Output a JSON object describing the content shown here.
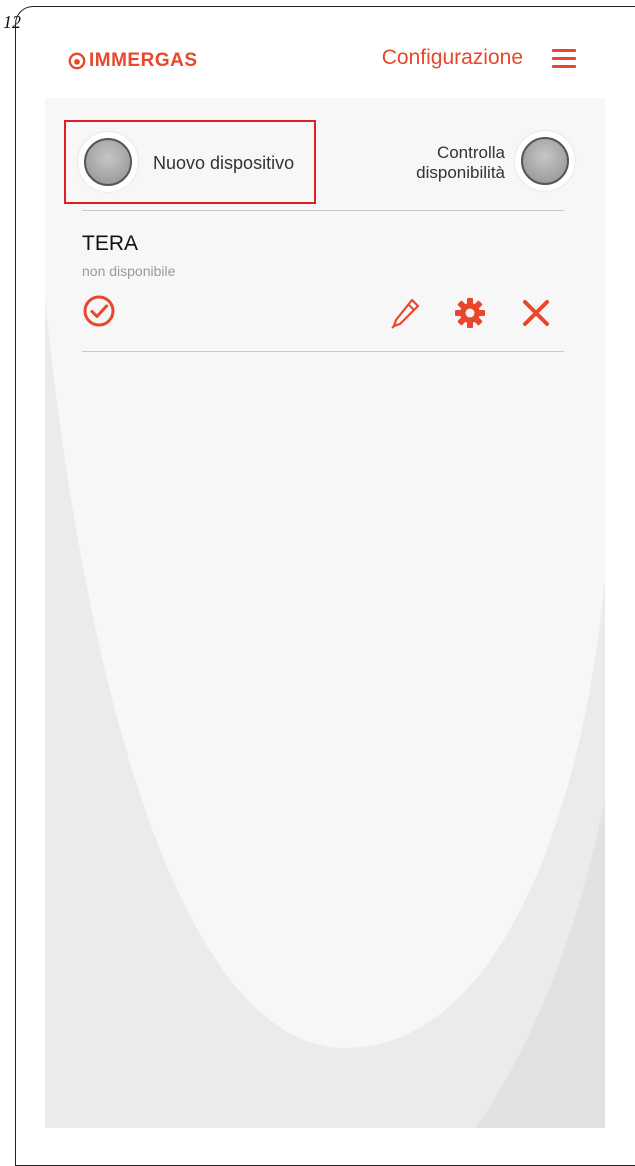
{
  "page_number": "12",
  "header": {
    "logo_text": "IMMERGAS",
    "title": "Configurazione"
  },
  "toolbar": {
    "new_device_label": "Nuovo dispositivo",
    "check_availability_line1": "Controlla",
    "check_availability_line2": "disponibilità"
  },
  "devices": [
    {
      "name": "TERA",
      "status": "non disponibile"
    }
  ],
  "icons": {
    "menu": "hamburger-menu-icon",
    "select": "check-circle-icon",
    "edit": "pencil-icon",
    "settings": "gear-icon",
    "delete": "close-icon"
  },
  "colors": {
    "accent": "#e8472b",
    "highlight": "#e01f25",
    "panel_bg": "#f2f2f2"
  }
}
